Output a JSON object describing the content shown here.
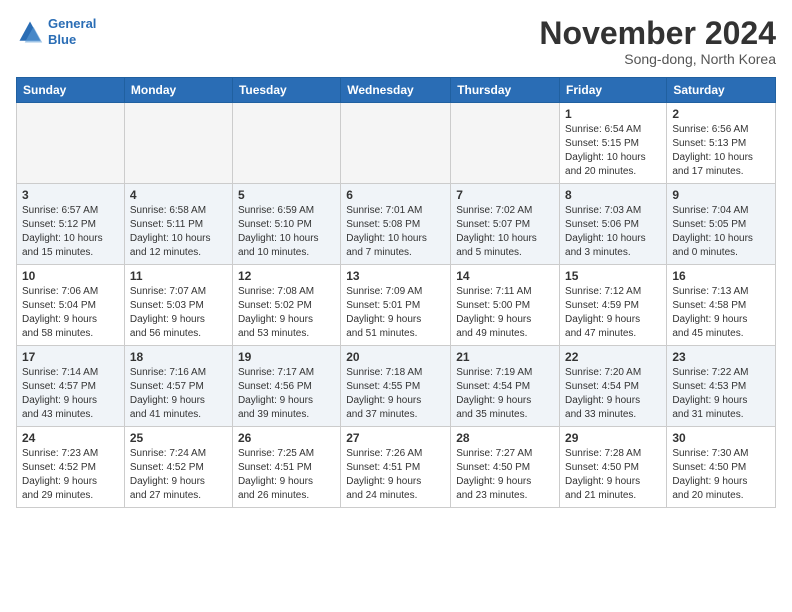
{
  "header": {
    "logo_line1": "General",
    "logo_line2": "Blue",
    "month": "November 2024",
    "location": "Song-dong, North Korea"
  },
  "weekdays": [
    "Sunday",
    "Monday",
    "Tuesday",
    "Wednesday",
    "Thursday",
    "Friday",
    "Saturday"
  ],
  "weeks": [
    [
      {
        "day": "",
        "info": ""
      },
      {
        "day": "",
        "info": ""
      },
      {
        "day": "",
        "info": ""
      },
      {
        "day": "",
        "info": ""
      },
      {
        "day": "",
        "info": ""
      },
      {
        "day": "1",
        "info": "Sunrise: 6:54 AM\nSunset: 5:15 PM\nDaylight: 10 hours\nand 20 minutes."
      },
      {
        "day": "2",
        "info": "Sunrise: 6:56 AM\nSunset: 5:13 PM\nDaylight: 10 hours\nand 17 minutes."
      }
    ],
    [
      {
        "day": "3",
        "info": "Sunrise: 6:57 AM\nSunset: 5:12 PM\nDaylight: 10 hours\nand 15 minutes."
      },
      {
        "day": "4",
        "info": "Sunrise: 6:58 AM\nSunset: 5:11 PM\nDaylight: 10 hours\nand 12 minutes."
      },
      {
        "day": "5",
        "info": "Sunrise: 6:59 AM\nSunset: 5:10 PM\nDaylight: 10 hours\nand 10 minutes."
      },
      {
        "day": "6",
        "info": "Sunrise: 7:01 AM\nSunset: 5:08 PM\nDaylight: 10 hours\nand 7 minutes."
      },
      {
        "day": "7",
        "info": "Sunrise: 7:02 AM\nSunset: 5:07 PM\nDaylight: 10 hours\nand 5 minutes."
      },
      {
        "day": "8",
        "info": "Sunrise: 7:03 AM\nSunset: 5:06 PM\nDaylight: 10 hours\nand 3 minutes."
      },
      {
        "day": "9",
        "info": "Sunrise: 7:04 AM\nSunset: 5:05 PM\nDaylight: 10 hours\nand 0 minutes."
      }
    ],
    [
      {
        "day": "10",
        "info": "Sunrise: 7:06 AM\nSunset: 5:04 PM\nDaylight: 9 hours\nand 58 minutes."
      },
      {
        "day": "11",
        "info": "Sunrise: 7:07 AM\nSunset: 5:03 PM\nDaylight: 9 hours\nand 56 minutes."
      },
      {
        "day": "12",
        "info": "Sunrise: 7:08 AM\nSunset: 5:02 PM\nDaylight: 9 hours\nand 53 minutes."
      },
      {
        "day": "13",
        "info": "Sunrise: 7:09 AM\nSunset: 5:01 PM\nDaylight: 9 hours\nand 51 minutes."
      },
      {
        "day": "14",
        "info": "Sunrise: 7:11 AM\nSunset: 5:00 PM\nDaylight: 9 hours\nand 49 minutes."
      },
      {
        "day": "15",
        "info": "Sunrise: 7:12 AM\nSunset: 4:59 PM\nDaylight: 9 hours\nand 47 minutes."
      },
      {
        "day": "16",
        "info": "Sunrise: 7:13 AM\nSunset: 4:58 PM\nDaylight: 9 hours\nand 45 minutes."
      }
    ],
    [
      {
        "day": "17",
        "info": "Sunrise: 7:14 AM\nSunset: 4:57 PM\nDaylight: 9 hours\nand 43 minutes."
      },
      {
        "day": "18",
        "info": "Sunrise: 7:16 AM\nSunset: 4:57 PM\nDaylight: 9 hours\nand 41 minutes."
      },
      {
        "day": "19",
        "info": "Sunrise: 7:17 AM\nSunset: 4:56 PM\nDaylight: 9 hours\nand 39 minutes."
      },
      {
        "day": "20",
        "info": "Sunrise: 7:18 AM\nSunset: 4:55 PM\nDaylight: 9 hours\nand 37 minutes."
      },
      {
        "day": "21",
        "info": "Sunrise: 7:19 AM\nSunset: 4:54 PM\nDaylight: 9 hours\nand 35 minutes."
      },
      {
        "day": "22",
        "info": "Sunrise: 7:20 AM\nSunset: 4:54 PM\nDaylight: 9 hours\nand 33 minutes."
      },
      {
        "day": "23",
        "info": "Sunrise: 7:22 AM\nSunset: 4:53 PM\nDaylight: 9 hours\nand 31 minutes."
      }
    ],
    [
      {
        "day": "24",
        "info": "Sunrise: 7:23 AM\nSunset: 4:52 PM\nDaylight: 9 hours\nand 29 minutes."
      },
      {
        "day": "25",
        "info": "Sunrise: 7:24 AM\nSunset: 4:52 PM\nDaylight: 9 hours\nand 27 minutes."
      },
      {
        "day": "26",
        "info": "Sunrise: 7:25 AM\nSunset: 4:51 PM\nDaylight: 9 hours\nand 26 minutes."
      },
      {
        "day": "27",
        "info": "Sunrise: 7:26 AM\nSunset: 4:51 PM\nDaylight: 9 hours\nand 24 minutes."
      },
      {
        "day": "28",
        "info": "Sunrise: 7:27 AM\nSunset: 4:50 PM\nDaylight: 9 hours\nand 23 minutes."
      },
      {
        "day": "29",
        "info": "Sunrise: 7:28 AM\nSunset: 4:50 PM\nDaylight: 9 hours\nand 21 minutes."
      },
      {
        "day": "30",
        "info": "Sunrise: 7:30 AM\nSunset: 4:50 PM\nDaylight: 9 hours\nand 20 minutes."
      }
    ]
  ]
}
